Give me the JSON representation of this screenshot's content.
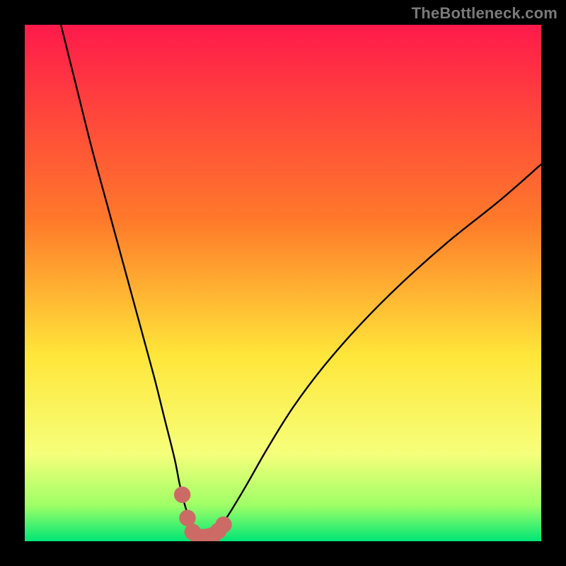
{
  "watermark": "TheBottleneck.com",
  "colors": {
    "background": "#000000",
    "gradient_top": "#ff1a4b",
    "gradient_mid1": "#ff7a2a",
    "gradient_mid2": "#ffe63a",
    "gradient_mid3": "#f6ff7a",
    "gradient_low": "#9fff66",
    "gradient_bottom": "#00e676",
    "curve": "#000000",
    "marker": "#cc6b66"
  },
  "chart_data": {
    "type": "line",
    "title": "",
    "xlabel": "",
    "ylabel": "",
    "xlim": [
      0,
      100
    ],
    "ylim": [
      0,
      100
    ],
    "grid": false,
    "legend": false,
    "annotations": [],
    "series": [
      {
        "name": "bottleneck-curve",
        "x": [
          7,
          10,
          13,
          16,
          19,
          22,
          25,
          27,
          29,
          30,
          31,
          32,
          33,
          34,
          35,
          36,
          37,
          38,
          40,
          43,
          47,
          52,
          58,
          65,
          73,
          82,
          92,
          100
        ],
        "y": [
          100,
          88,
          76,
          65,
          54,
          43,
          32,
          24,
          16,
          11,
          7,
          4,
          2,
          1,
          1,
          1,
          2,
          3,
          6,
          11,
          18,
          26,
          34,
          42,
          50,
          58,
          66,
          73
        ]
      }
    ],
    "markers": {
      "name": "highlight-dots",
      "points": [
        {
          "x": 30.5,
          "y": 9
        },
        {
          "x": 31.5,
          "y": 4.5
        },
        {
          "x": 32.5,
          "y": 1.8
        },
        {
          "x": 33.5,
          "y": 0.9
        },
        {
          "x": 34.5,
          "y": 0.8
        },
        {
          "x": 35.5,
          "y": 0.9
        },
        {
          "x": 36.5,
          "y": 1.2
        },
        {
          "x": 37.5,
          "y": 2.0
        },
        {
          "x": 38.5,
          "y": 3.2
        }
      ],
      "radius_data_units": 1.6
    }
  }
}
